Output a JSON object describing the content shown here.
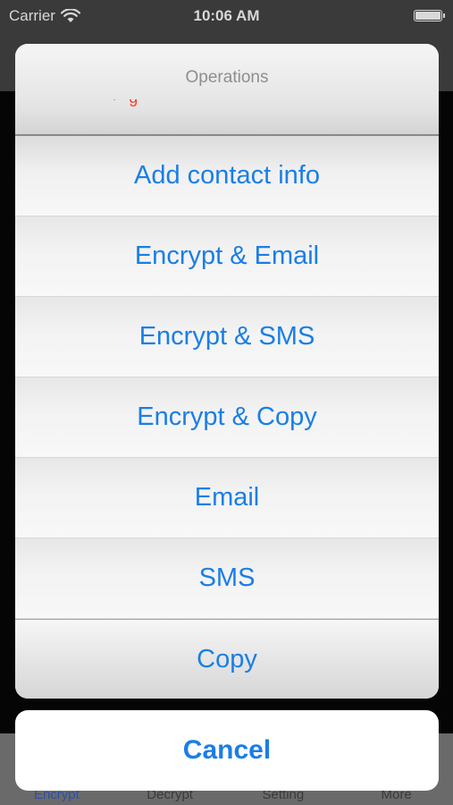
{
  "status_bar": {
    "carrier": "Carrier",
    "time": "10:06 AM"
  },
  "action_sheet": {
    "title": "Operations",
    "buttons": [
      "Add contact info",
      "Encrypt & Email",
      "Encrypt & SMS",
      "Encrypt & Copy",
      "Email",
      "SMS",
      "Copy"
    ],
    "cancel_label": "Cancel"
  },
  "tab_bar": {
    "items": [
      "Encrypt",
      "Decrypt",
      "Setting",
      "More"
    ],
    "active_index": 0
  },
  "colors": {
    "accent": "#1a7ee6",
    "active_tab": "#2b4fa8",
    "destructive_hint": "#ff3b30"
  }
}
